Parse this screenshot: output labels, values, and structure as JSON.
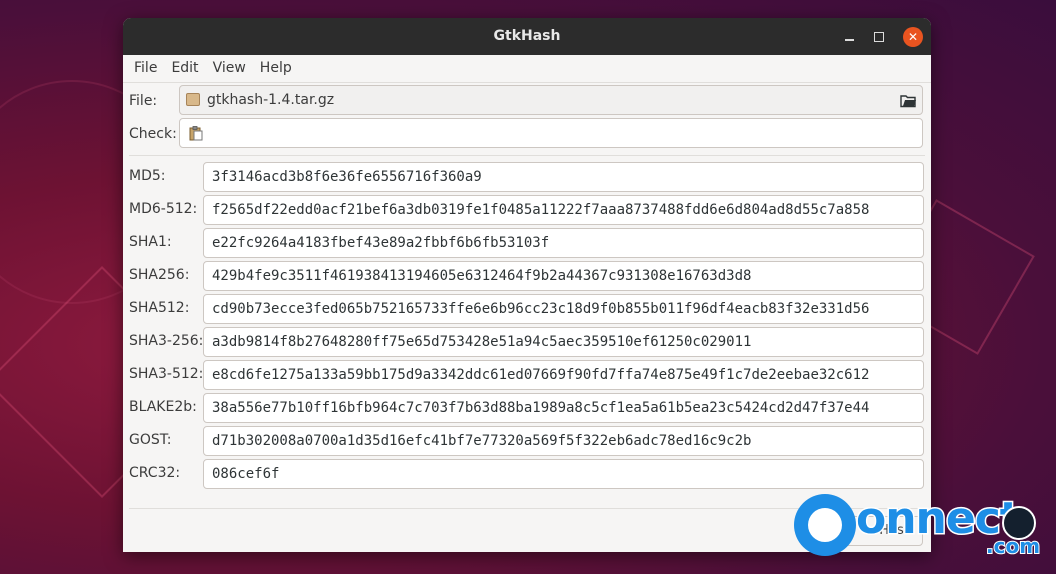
{
  "window": {
    "title": "GtkHash"
  },
  "menu": [
    "File",
    "Edit",
    "View",
    "Help"
  ],
  "file": {
    "label": "File:",
    "value": "gtkhash-1.4.tar.gz"
  },
  "check": {
    "label": "Check:",
    "value": ""
  },
  "hashes": [
    {
      "label": "MD5:",
      "value": "3f3146acd3b8f6e36fe6556716f360a9"
    },
    {
      "label": "MD6-512:",
      "value": "f2565df22edd0acf21bef6a3db0319fe1f0485a11222f7aaa8737488fdd6e6d804ad8d55c7a858"
    },
    {
      "label": "SHA1:",
      "value": "e22fc9264a4183fbef43e89a2fbbf6b6fb53103f"
    },
    {
      "label": "SHA256:",
      "value": "429b4fe9c3511f461938413194605e6312464f9b2a44367c931308e16763d3d8"
    },
    {
      "label": "SHA512:",
      "value": "cd90b73ecce3fed065b752165733ffe6e6b96cc23c18d9f0b855b011f96df4eacb83f32e331d56"
    },
    {
      "label": "SHA3-256:",
      "value": "a3db9814f8b27648280ff75e65d753428e51a94c5aec359510ef61250c029011"
    },
    {
      "label": "SHA3-512:",
      "value": "e8cd6fe1275a133a59bb175d9a3342ddc61ed07669f90fd7ffa74e875e49f1c7de2eebae32c612"
    },
    {
      "label": "BLAKE2b:",
      "value": "38a556e77b10ff16bfb964c7c703f7b63d88ba1989a8c5cf1ea5a61b5ea23c5424cd2d47f37e44"
    },
    {
      "label": "GOST:",
      "value": "d71b302008a0700a1d35d16efc41bf7e77320a569f5f322eb6adc78ed16c9c2b"
    },
    {
      "label": "CRC32:",
      "value": "086cef6f"
    }
  ],
  "hash_button": {
    "label": "Hash"
  },
  "watermark": {
    "text": "onnect",
    "suffix": ".com"
  },
  "colors": {
    "accent": "#e95420",
    "titlebar": "#2c2c2c",
    "watermark": "#1e8ee6"
  }
}
